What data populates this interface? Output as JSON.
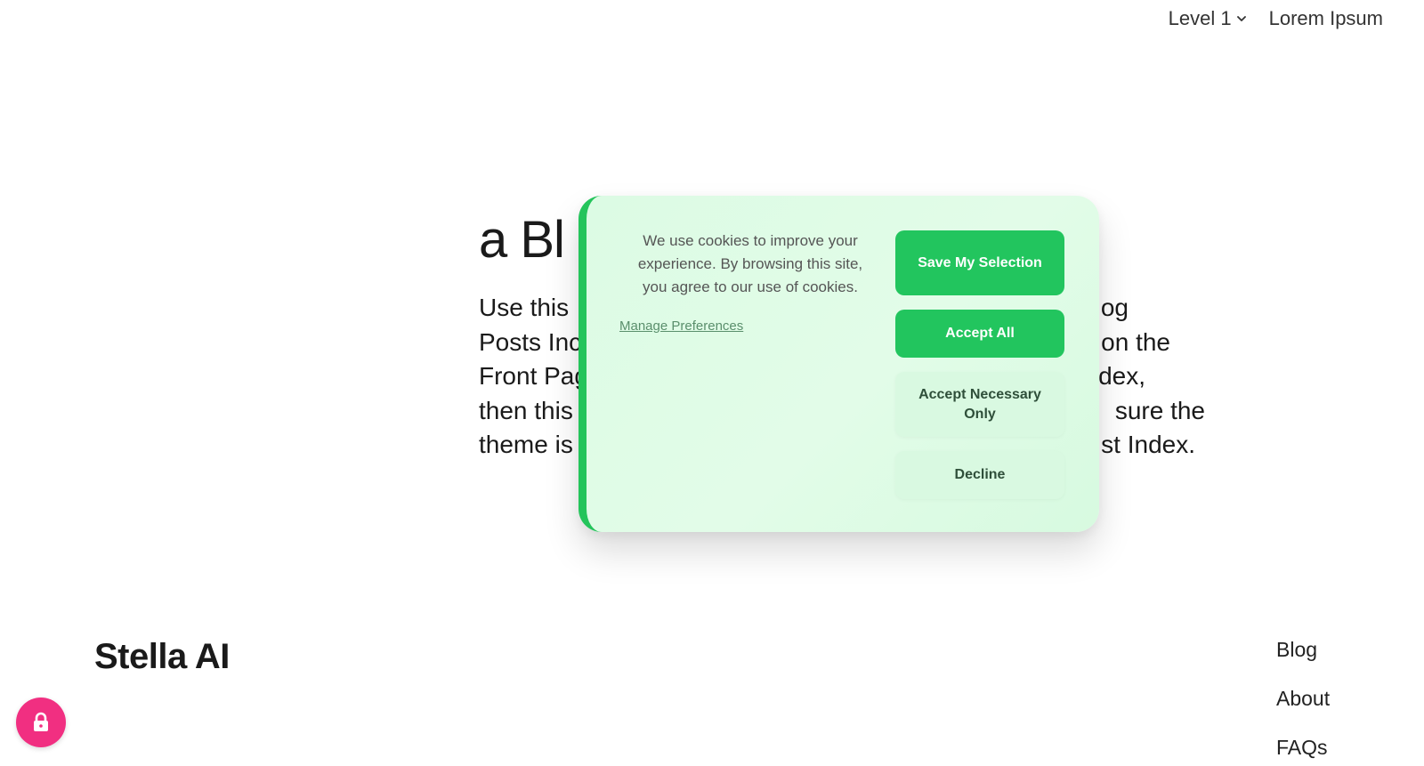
{
  "nav": {
    "items": [
      {
        "label": "Level 1",
        "has_dropdown": true,
        "icon": "chevron-down-icon"
      },
      {
        "label": "Lorem Ipsum"
      }
    ]
  },
  "hero": {
    "title_visible": "a Bl",
    "lines": [
      {
        "left": "Use this",
        "right": "Blog"
      },
      {
        "left": "Posts Inc",
        "right": "on the"
      },
      {
        "left": "Front Pag",
        "right": "Index,"
      },
      {
        "left": "then this",
        "right": "sure the"
      },
      {
        "left": "theme is",
        "right": "st Index."
      }
    ]
  },
  "cookie": {
    "message": "We use cookies to improve your experience. By browsing this site, you agree to our use of cookies.",
    "manage_link": "Manage Preferences",
    "buttons": {
      "save": "Save My Selection",
      "accept_all": "Accept All",
      "necessary": "Accept Necessary Only",
      "decline": "Decline"
    },
    "colors": {
      "accent": "#22c55e",
      "background": "#dcfbe4"
    }
  },
  "footer": {
    "brand": "Stella AI",
    "links": [
      "Blog",
      "About",
      "FAQs"
    ]
  },
  "lock_button": {
    "icon": "lock-icon",
    "color": "#f12f81"
  }
}
